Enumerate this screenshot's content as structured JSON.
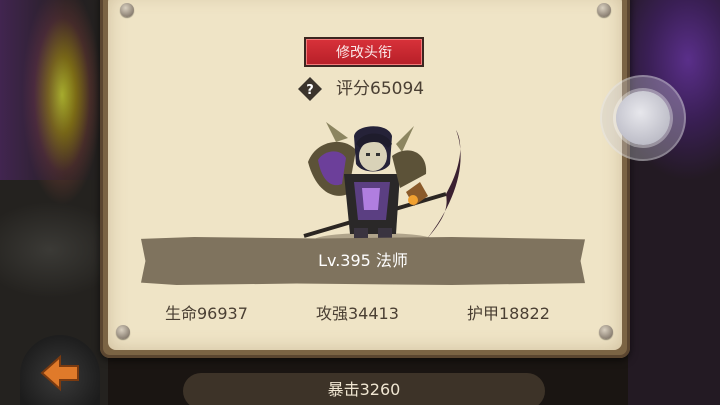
{
  "header": {
    "rename_button": "修改头衔"
  },
  "score": {
    "help_icon": "question-icon",
    "text": "评分65094"
  },
  "hero": {
    "level_class": "Lv.395 法师"
  },
  "stats": {
    "hp": "生命96937",
    "attack": "攻强34413",
    "armor": "护甲18822",
    "crit": "暴击3260"
  },
  "controls": {
    "back_icon": "back-arrow-icon",
    "joystick_icon": "joystick-icon"
  },
  "colors": {
    "panel_bg": "#efe4c6",
    "banner_bg": "#7f735e",
    "rename_button_bg": "#c8262f",
    "text_dark": "#4a3f33"
  }
}
